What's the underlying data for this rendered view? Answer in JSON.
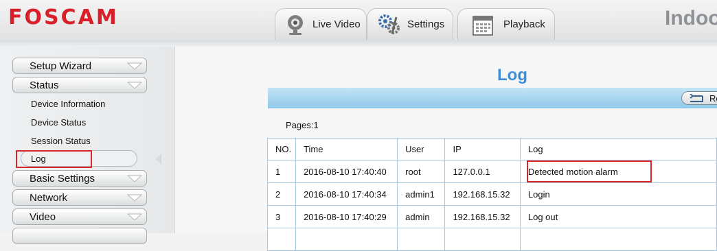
{
  "header": {
    "logo": "FOSCAM",
    "brand_right": "Indoo",
    "tabs": [
      {
        "label": "Live Video",
        "icon": "webcam-icon"
      },
      {
        "label": "Settings",
        "icon": "gears-icon"
      },
      {
        "label": "Playback",
        "icon": "calendar-icon"
      }
    ]
  },
  "sidebar": {
    "menus": [
      {
        "label": "Setup Wizard"
      },
      {
        "label": "Status"
      }
    ],
    "status_sub": [
      "Device Information",
      "Device Status",
      "Session Status",
      "Log"
    ],
    "menus_after": [
      {
        "label": "Basic Settings"
      },
      {
        "label": "Network"
      },
      {
        "label": "Video"
      }
    ]
  },
  "main": {
    "title": "Log",
    "refresh_label": "Re",
    "pages": "Pages:1",
    "table": {
      "headers": [
        "NO.",
        "Time",
        "User",
        "IP",
        "Log"
      ],
      "rows": [
        [
          "1",
          "2016-08-10 17:40:40",
          "root",
          "127.0.0.1",
          "Detected motion alarm"
        ],
        [
          "2",
          "2016-08-10 17:40:34",
          "admin1",
          "192.168.15.32",
          "Login"
        ],
        [
          "3",
          "2016-08-10 17:40:29",
          "admin",
          "192.168.15.32",
          "Log out"
        ]
      ]
    }
  },
  "colors": {
    "logo_red": "#d9202a",
    "title_blue": "#3e8ed6",
    "highlight_red": "#d9262b",
    "table_border": "#a6c8e0"
  }
}
